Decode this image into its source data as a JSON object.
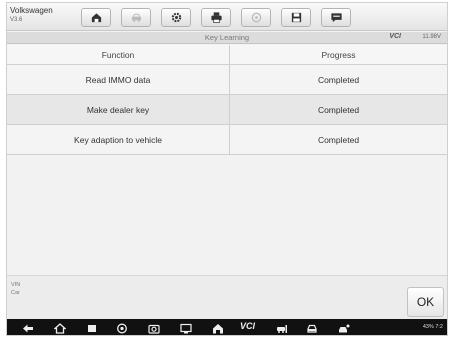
{
  "header": {
    "vehicle_name": "Volkswagen",
    "vehicle_version": "V3.6",
    "buttons": [
      {
        "name": "home-button",
        "icon": "home-icon"
      },
      {
        "name": "vehicle-swap-button",
        "icon": "car-swap-icon"
      },
      {
        "name": "settings-button",
        "icon": "gear-icon"
      },
      {
        "name": "print-button",
        "icon": "printer-icon"
      },
      {
        "name": "help-button",
        "icon": "help-icon"
      },
      {
        "name": "save-button",
        "icon": "save-icon"
      },
      {
        "name": "data-logging-button",
        "icon": "chat-icon"
      }
    ]
  },
  "title_bar": {
    "title": "Key Learning",
    "vci": "VCI",
    "battery_voltage": "11.98V"
  },
  "table": {
    "columns": [
      "Function",
      "Progress"
    ],
    "rows": [
      {
        "function": "Read IMMO data",
        "progress": "Completed"
      },
      {
        "function": "Make dealer key",
        "progress": "Completed"
      },
      {
        "function": "Key adaption to vehicle",
        "progress": "Completed"
      }
    ]
  },
  "info": {
    "vin_label": "VIN",
    "car_label": "Car"
  },
  "actions": {
    "ok_label": "OK"
  },
  "navbar": {
    "vci_label": "VCI",
    "status": "43% 7:2"
  },
  "colors": {
    "toolbar_bg": "#e8e8e8",
    "title_strip": "#dcdcdc",
    "navbar_bg": "#111111"
  }
}
